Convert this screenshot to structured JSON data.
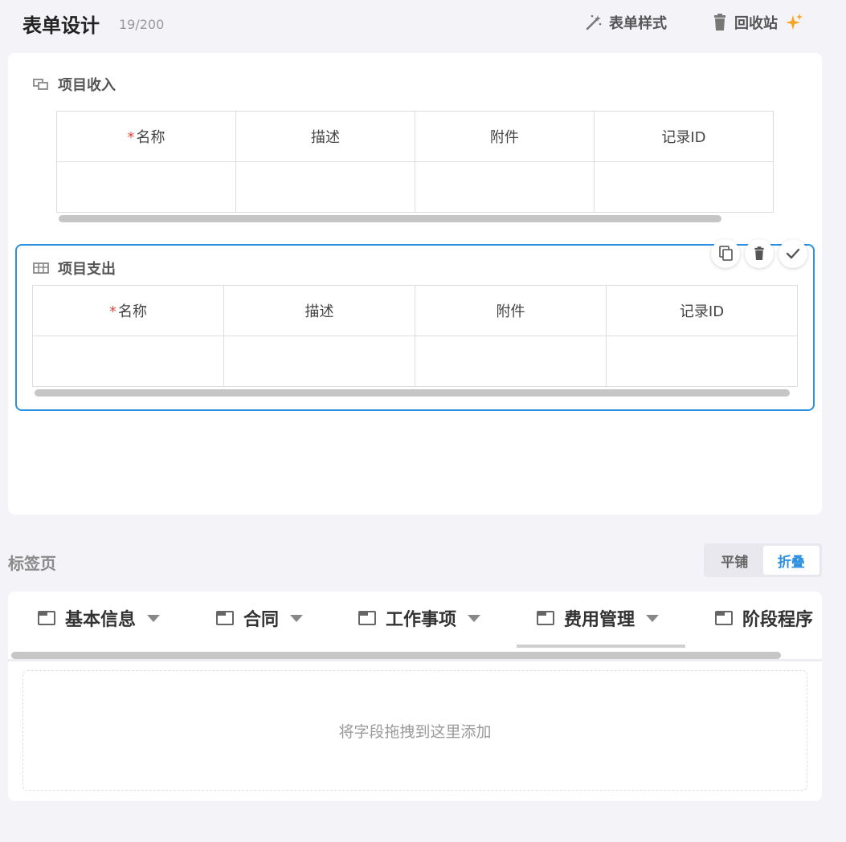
{
  "header": {
    "title": "表单设计",
    "count": "19/200",
    "style_btn": "表单样式",
    "recycle_btn": "回收站"
  },
  "sub_tables": [
    {
      "title": "项目收入",
      "columns": [
        "名称",
        "描述",
        "附件",
        "记录ID"
      ],
      "required": [
        true,
        false,
        false,
        false
      ]
    },
    {
      "title": "项目支出",
      "columns": [
        "名称",
        "描述",
        "附件",
        "记录ID"
      ],
      "required": [
        true,
        false,
        false,
        false
      ]
    }
  ],
  "tab_section": {
    "label": "标签页",
    "mode_options": [
      "平铺",
      "折叠"
    ],
    "mode_selected": "折叠",
    "tabs": [
      "基本信息",
      "合同",
      "工作事项",
      "费用管理",
      "阶段程序"
    ],
    "active_tab": "费用管理",
    "drop_hint": "将字段拖拽到这里添加"
  },
  "colors": {
    "accent": "#2d8fe0",
    "required": "#e5483c",
    "sparkle": "#f5a623"
  }
}
